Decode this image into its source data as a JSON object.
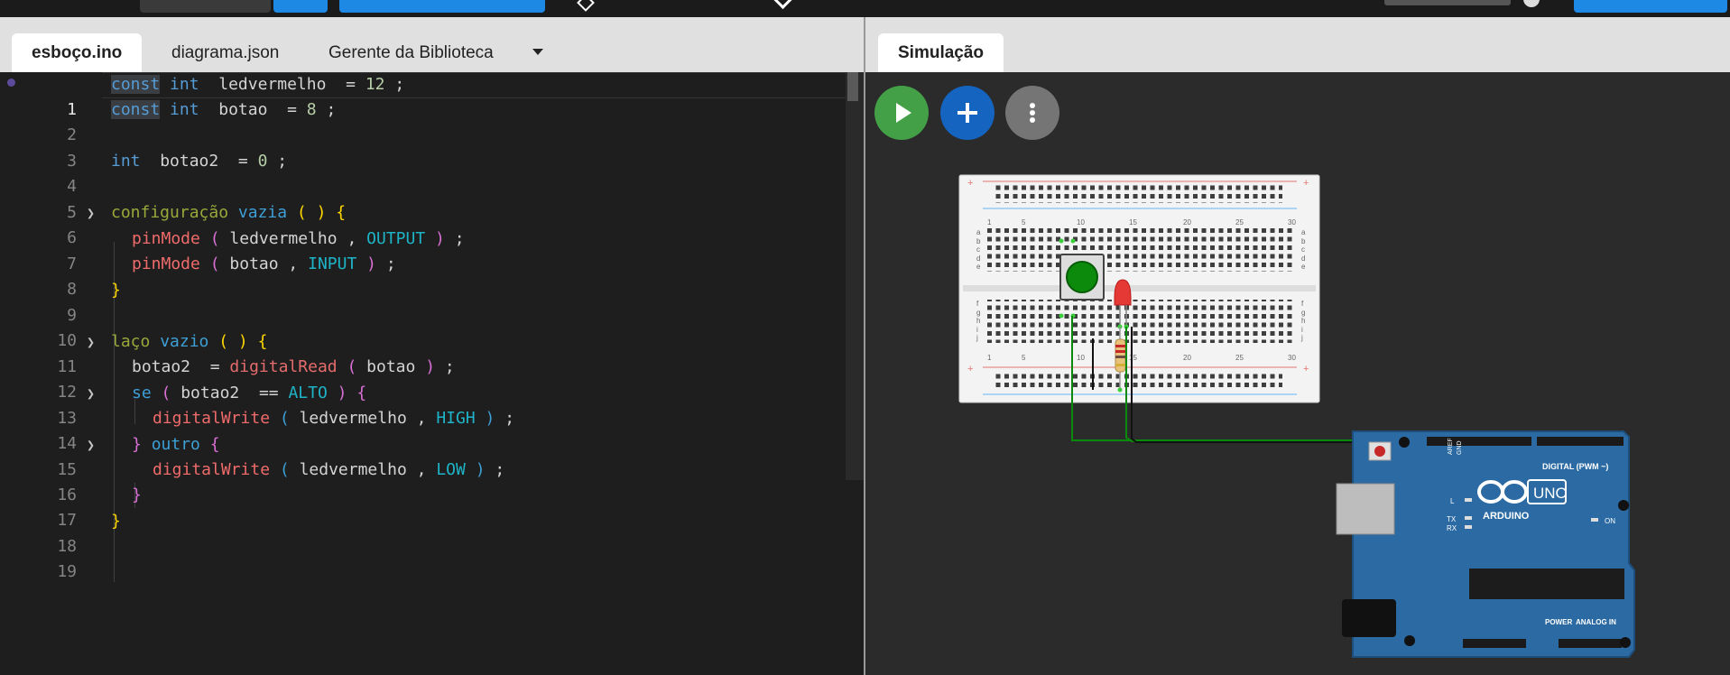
{
  "editor": {
    "tabs": [
      {
        "label": "esboço.ino",
        "active": true
      },
      {
        "label": "diagrama.json",
        "active": false
      },
      {
        "label": "Gerente da Biblioteca",
        "active": false
      }
    ],
    "line_numbers": [
      "1",
      "2",
      "3",
      "4",
      "5",
      "6",
      "7",
      "8",
      "9",
      "10",
      "11",
      "12",
      "13",
      "14",
      "15",
      "16",
      "17",
      "18",
      "19"
    ],
    "code": {
      "l1": [
        "const",
        "int",
        "ledvermelho",
        "=",
        "12",
        ";"
      ],
      "l2": [
        "const",
        "int",
        "botao",
        "=",
        "8",
        ";"
      ],
      "l4": [
        "int",
        "botao2",
        "=",
        "0",
        ";"
      ],
      "l6": [
        "configuração",
        "vazia",
        "(",
        ")",
        "{"
      ],
      "l7": [
        "pinMode",
        "(",
        "ledvermelho",
        ",",
        "OUTPUT",
        ")",
        ";"
      ],
      "l8": [
        "pinMode",
        "(",
        "botao",
        ",",
        "INPUT",
        ")",
        ";"
      ],
      "l9": [
        "}"
      ],
      "l11": [
        "laço",
        "vazio",
        "(",
        ")",
        "{"
      ],
      "l12": [
        "botao2",
        "=",
        "digitalRead",
        "(",
        "botao",
        ")",
        ";"
      ],
      "l13": [
        "se",
        "(",
        "botao2",
        "==",
        "ALTO",
        ")",
        "{"
      ],
      "l14": [
        "digitalWrite",
        "(",
        "ledvermelho",
        ",",
        "HIGH",
        ")",
        ";"
      ],
      "l15": [
        "}",
        "outro",
        "{"
      ],
      "l16": [
        "digitalWrite",
        "(",
        "ledvermelho",
        ",",
        "LOW",
        ")",
        ";"
      ],
      "l17": [
        "}"
      ],
      "l18": [
        "}"
      ]
    }
  },
  "simulation": {
    "tab_label": "Simulação",
    "buttons": {
      "play": "play-icon",
      "add": "plus-icon",
      "more": "more-vertical-icon"
    },
    "breadboard": {
      "col_labels": [
        "1",
        "5",
        "10",
        "15",
        "20",
        "25",
        "30"
      ],
      "row_labels_top": [
        "a",
        "b",
        "c",
        "d",
        "e"
      ],
      "row_labels_bottom": [
        "f",
        "g",
        "h",
        "i",
        "j"
      ]
    },
    "arduino": {
      "brand": "ARDUINO",
      "model": "UNO",
      "digital_label": "DIGITAL (PWM ~)",
      "power_label": "POWER",
      "analog_label": "ANALOG IN",
      "aref": "AREF",
      "gnd": "GND",
      "tx": "TX",
      "rx": "RX",
      "l": "L",
      "on": "ON"
    }
  },
  "colors": {
    "play": "#43a047",
    "add": "#1565c0",
    "more": "#757575",
    "wire_green": "#0a8a0a",
    "arduino_blue": "#2b6aa3"
  }
}
